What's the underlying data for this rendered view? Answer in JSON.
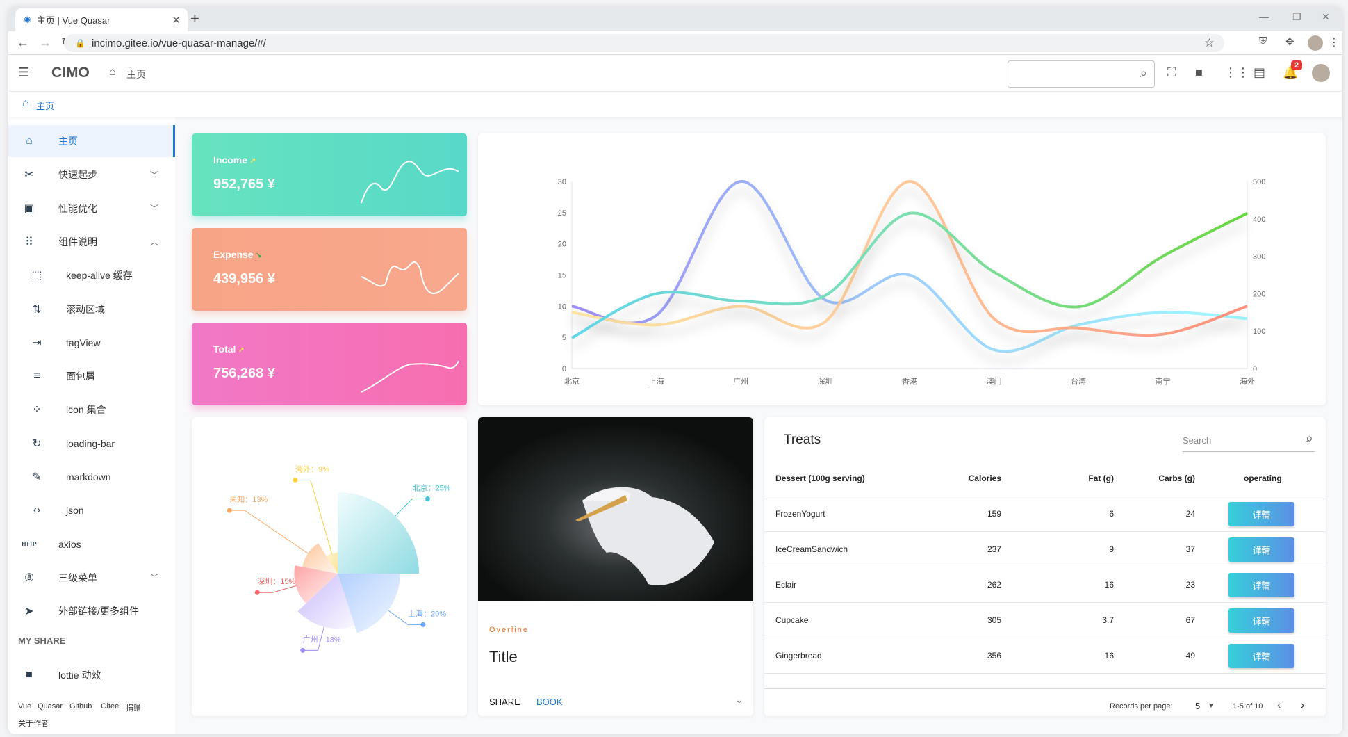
{
  "browser": {
    "tab_title": "主页 | Vue Quasar",
    "url": "incimo.gitee.io/vue-quasar-manage/#/"
  },
  "header": {
    "logo": "CIMO",
    "home_label": "主页",
    "search_placeholder": "",
    "notification_count": "2"
  },
  "breadcrumb": {
    "home": "主页"
  },
  "sidebar": {
    "items": [
      {
        "label": "主页",
        "icon": "home-icon",
        "active": true
      },
      {
        "label": "快速起步",
        "icon": "tools-icon",
        "chevron": "down"
      },
      {
        "label": "性能优化",
        "icon": "chip-icon",
        "chevron": "down"
      },
      {
        "label": "组件说明",
        "icon": "apps-icon",
        "chevron": "up"
      },
      {
        "label": "keep-alive 缓存",
        "icon": "select-all-icon",
        "sub": true
      },
      {
        "label": "滚动区域",
        "icon": "swap-vert-icon",
        "sub": true
      },
      {
        "label": "tagView",
        "icon": "input-icon",
        "sub": true
      },
      {
        "label": "面包屑",
        "icon": "notes-icon",
        "sub": true
      },
      {
        "label": "icon 集合",
        "icon": "grain-icon",
        "sub": true
      },
      {
        "label": "loading-bar",
        "icon": "rotate-icon",
        "sub": true
      },
      {
        "label": "markdown",
        "icon": "edit-note-icon",
        "sub": true
      },
      {
        "label": "json",
        "icon": "code-icon",
        "sub": true
      },
      {
        "label": "axios",
        "icon": "http-icon"
      },
      {
        "label": "三级菜单",
        "icon": "filter-3-icon",
        "chevron": "down"
      },
      {
        "label": "外部链接/更多组件",
        "icon": "send-icon"
      }
    ],
    "section": "MY SHARE",
    "share_items": [
      {
        "label": "lottie 动效",
        "icon": "videocam-icon"
      }
    ],
    "footer_links": [
      "Vue",
      "Quasar",
      "Github",
      "Gitee",
      "捐赠",
      "关于作者"
    ]
  },
  "stats": [
    {
      "title": "Income",
      "value": "952,765 ¥",
      "trend": "up",
      "color_from": "#67e3bf",
      "color_to": "#58d8c8"
    },
    {
      "title": "Expense",
      "value": "439,956 ¥",
      "trend": "down",
      "color_from": "#f7a386",
      "color_to": "#f8a88d"
    },
    {
      "title": "Total",
      "value": "756,268 ¥",
      "trend": "up",
      "color_from": "#f178c6",
      "color_to": "#f76eb0"
    }
  ],
  "chart_data": [
    {
      "type": "line",
      "smooth": true,
      "categories": [
        "北京",
        "上海",
        "广州",
        "深圳",
        "香港",
        "澳门",
        "台湾",
        "南宁",
        "海外"
      ],
      "y_left": {
        "ticks": [
          0,
          5,
          10,
          15,
          20,
          25,
          30
        ],
        "range": [
          0,
          30
        ]
      },
      "y_right": {
        "ticks": [
          0,
          100,
          200,
          300,
          400,
          500
        ],
        "range": [
          0,
          500
        ]
      },
      "grid": false,
      "series": [
        {
          "axis": "left",
          "values": [
            10,
            8.5,
            30,
            11,
            15,
            3,
            7,
            9,
            8
          ],
          "colors": [
            "#9d8cf5",
            "#9fd0fb",
            "#9ff8ff"
          ]
        },
        {
          "axis": "left",
          "values": [
            9,
            7,
            10,
            7.5,
            30,
            8,
            6.5,
            5.5,
            10
          ],
          "colors": [
            "#fde3a1",
            "#ffc89b",
            "#ff8f7c"
          ]
        },
        {
          "axis": "right",
          "values": [
            82,
            200,
            180,
            195,
            415,
            258,
            165,
            300,
            415
          ],
          "colors": [
            "#62d6e8",
            "#7ee0b0",
            "#6bd640"
          ]
        }
      ]
    },
    {
      "type": "pie",
      "rose": true,
      "slices": [
        {
          "label": "北京",
          "value": 25,
          "color": "#3fc5d4",
          "fill": [
            "#f2fcfd",
            "#8fdbe2"
          ]
        },
        {
          "label": "上海",
          "value": 20,
          "color": "#6ea6fb",
          "fill": [
            "#b3d0ff",
            "#f2f7ff"
          ]
        },
        {
          "label": "广州",
          "value": 18,
          "color": "#a18cf8",
          "fill": [
            "#c8bafc",
            "#faf8ff"
          ]
        },
        {
          "label": "深圳",
          "value": 15,
          "color": "#f56a6a",
          "fill": [
            "#fea4a4",
            "#fff4f2"
          ]
        },
        {
          "label": "未知",
          "value": 13,
          "color": "#fdaa62",
          "fill": [
            "#fec69a",
            "#fff6ef"
          ]
        },
        {
          "label": "海外",
          "value": 9,
          "color": "#fdd046",
          "fill": [
            "#fff3cf",
            "#fee49a"
          ]
        }
      ]
    }
  ],
  "media_card": {
    "overline": "Overline",
    "title": "Title",
    "actions": [
      "SHARE",
      "BOOK"
    ]
  },
  "table": {
    "title": "Treats",
    "search_placeholder": "Search",
    "columns": [
      "Dessert (100g serving)",
      "Calories",
      "Fat (g)",
      "Carbs (g)",
      "operating"
    ],
    "rows": [
      {
        "name": "FrozenYogurt",
        "calories": "159",
        "fat": "6",
        "carbs": "24"
      },
      {
        "name": "IceCreamSandwich",
        "calories": "237",
        "fat": "9",
        "carbs": "37"
      },
      {
        "name": "Eclair",
        "calories": "262",
        "fat": "16",
        "carbs": "23"
      },
      {
        "name": "Cupcake",
        "calories": "305",
        "fat": "3.7",
        "carbs": "67"
      },
      {
        "name": "Gingerbread",
        "calories": "356",
        "fat": "16",
        "carbs": "49"
      }
    ],
    "button_label": "详情",
    "pagination": {
      "records_label": "Records per page:",
      "per_page": "5",
      "range": "1-5 of 10"
    }
  }
}
